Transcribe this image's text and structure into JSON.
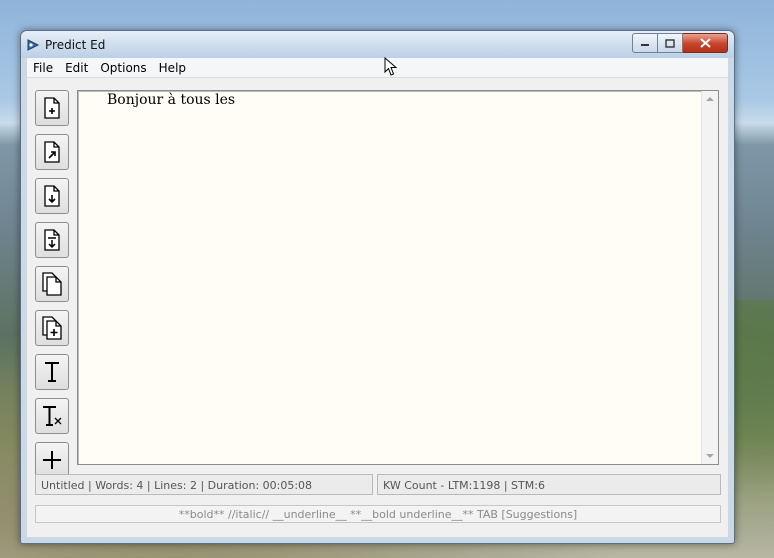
{
  "window": {
    "title": "Predict Ed"
  },
  "menu": {
    "items": [
      "File",
      "Edit",
      "Options",
      "Help"
    ]
  },
  "toolbar": {
    "buttons": [
      {
        "icon": "new-document-icon"
      },
      {
        "icon": "open-document-icon"
      },
      {
        "icon": "save-document-icon"
      },
      {
        "icon": "save-as-document-icon"
      },
      {
        "icon": "copy-pages-icon"
      },
      {
        "icon": "add-pages-icon"
      },
      {
        "icon": "text-icon"
      },
      {
        "icon": "clear-text-icon"
      },
      {
        "icon": "plus-icon"
      }
    ]
  },
  "editor": {
    "text": "Bonjour à tous les"
  },
  "status": {
    "left": "Untitled | Words: 4 | Lines: 2 | Duration: 00:05:08",
    "right": "KW Count - LTM:1198 | STM:6"
  },
  "hints": {
    "text": "**bold**   //italic//   __underline__  **__bold underline__**  TAB [Suggestions]"
  }
}
